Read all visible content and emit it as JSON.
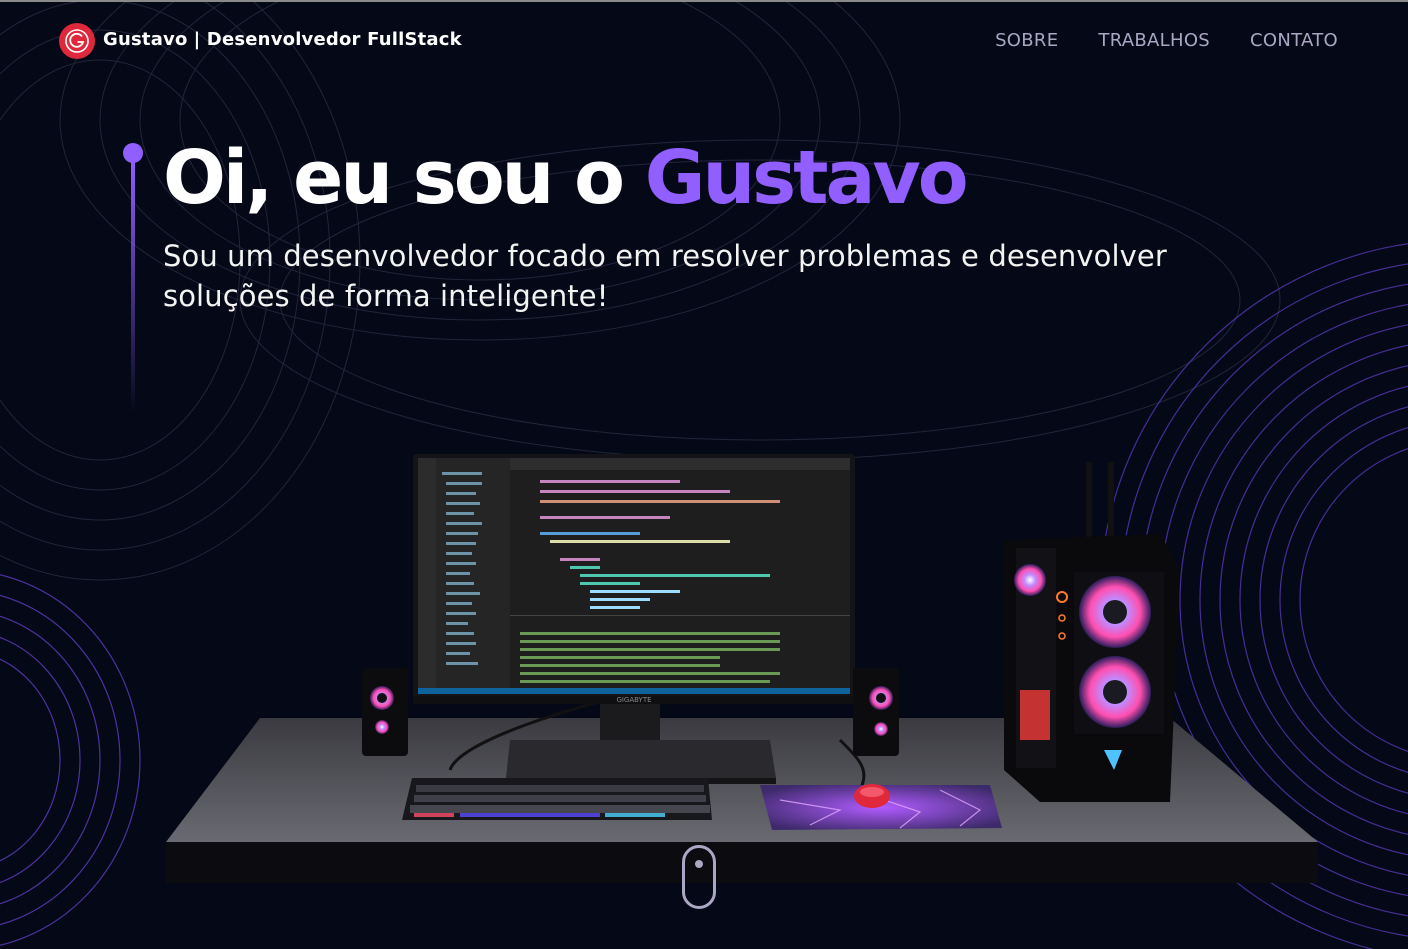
{
  "nav": {
    "brand_name": "Gustavo",
    "brand_tagline": "| Desenvolvedor FullStack",
    "links": [
      "SOBRE",
      "TRABALHOS",
      "CONTATO"
    ]
  },
  "hero": {
    "greeting": "Oi, eu sou o ",
    "name": "Gustavo",
    "subtitle": "Sou um desenvolvedor focado em resolver problemas e desenvolver soluções de forma inteligente!"
  },
  "monitor": {
    "brand": "GIGABYTE"
  },
  "icons": {
    "logo": "logo-g-icon",
    "scroll": "mouse-scroll-icon"
  },
  "colors": {
    "accent": "#915eff",
    "background": "#050816",
    "logo": "#e0283c",
    "nav_text": "#aaa6c3"
  }
}
